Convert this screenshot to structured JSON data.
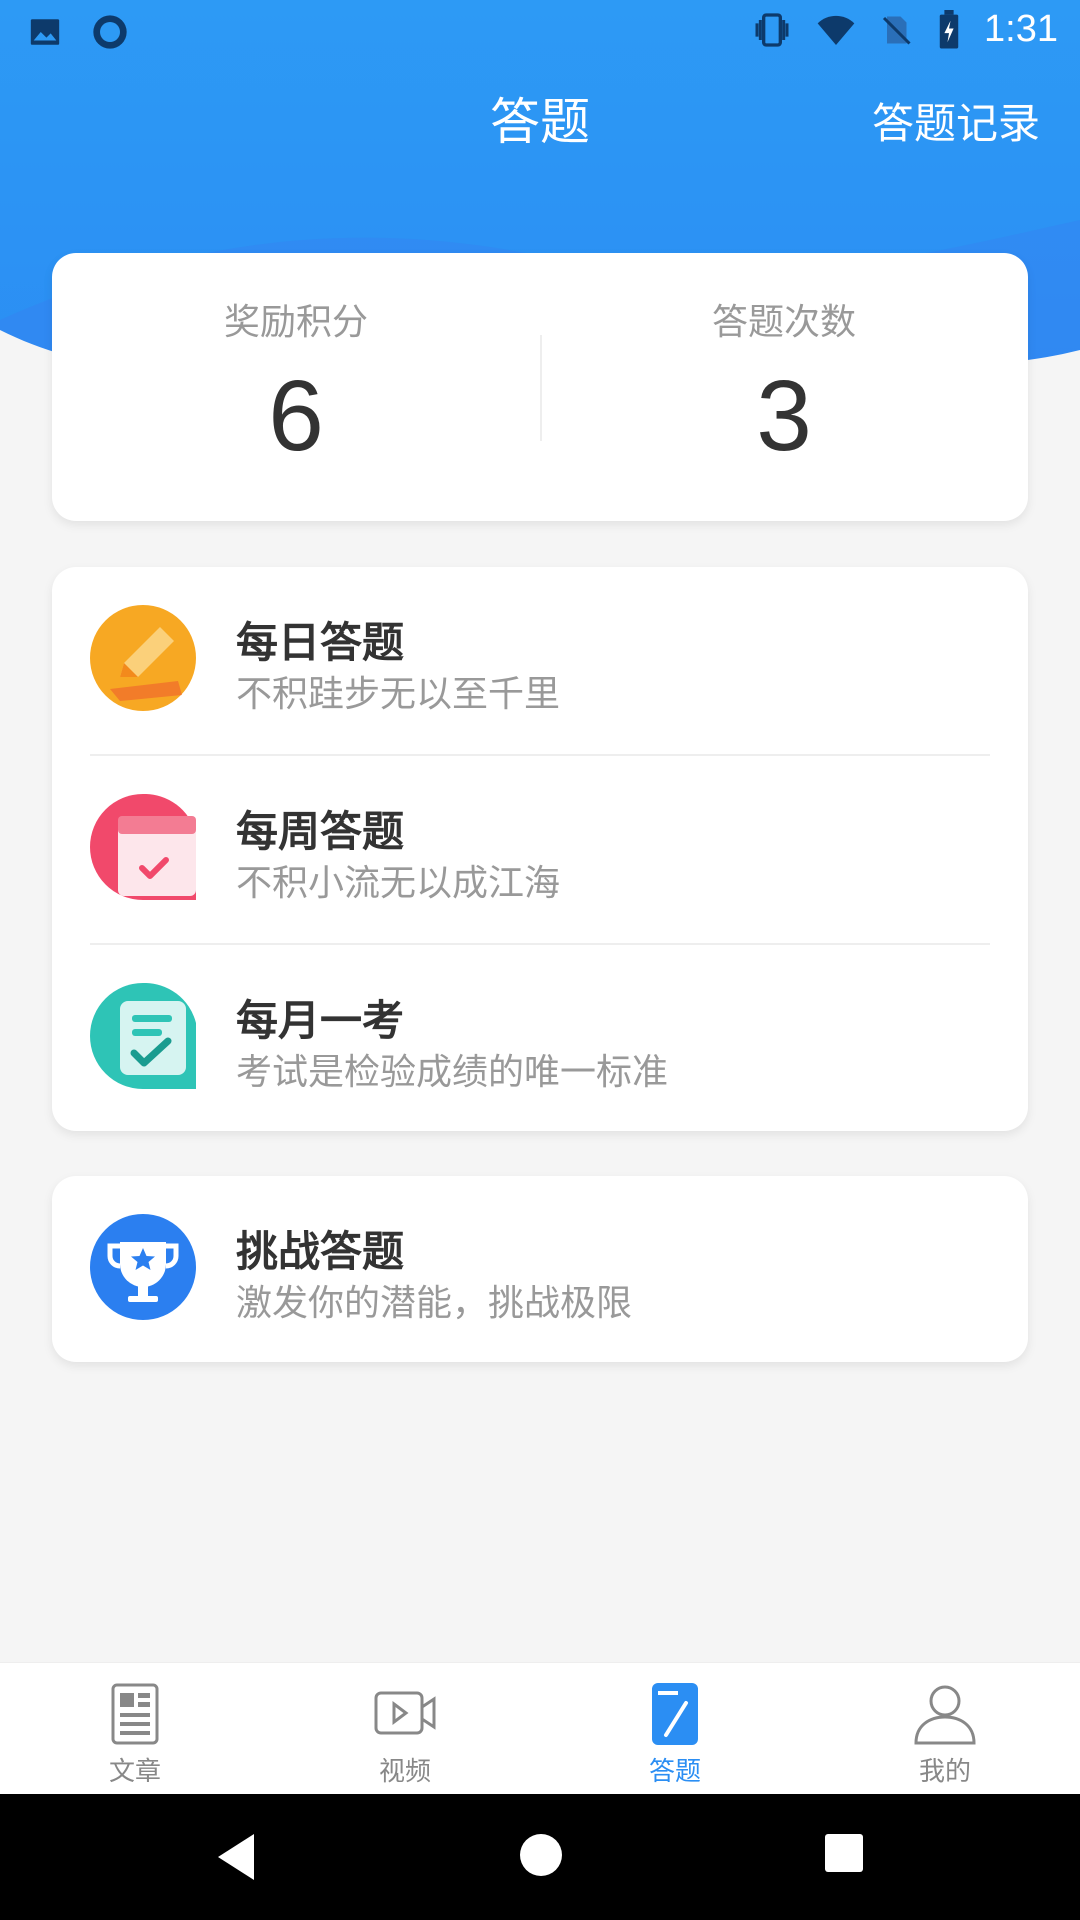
{
  "status_bar": {
    "time": "1:31"
  },
  "header": {
    "title": "答题",
    "records_label": "答题记录"
  },
  "stats": {
    "points_label": "奖励积分",
    "points_value": "6",
    "count_label": "答题次数",
    "count_value": "3"
  },
  "quiz_list": [
    {
      "title": "每日答题",
      "subtitle": "不积跬步无以至千里",
      "icon": "pencil-icon",
      "color": "#f7a823"
    },
    {
      "title": "每周答题",
      "subtitle": "不积小流无以成江海",
      "icon": "calendar-icon",
      "color": "#f1496b"
    },
    {
      "title": "每月一考",
      "subtitle": "考试是检验成绩的唯一标准",
      "icon": "exam-icon",
      "color": "#2ec4b6"
    }
  ],
  "challenge": {
    "title": "挑战答题",
    "subtitle": "激发你的潜能，挑战极限",
    "icon": "trophy-icon",
    "color": "#2b7ff0"
  },
  "bottom_nav": [
    {
      "label": "文章",
      "icon": "article-icon"
    },
    {
      "label": "视频",
      "icon": "video-icon"
    },
    {
      "label": "答题",
      "icon": "quiz-icon",
      "active": true
    },
    {
      "label": "我的",
      "icon": "profile-icon"
    }
  ],
  "colors": {
    "primary": "#2b8ef3",
    "text": "#333333",
    "muted": "#999999"
  }
}
